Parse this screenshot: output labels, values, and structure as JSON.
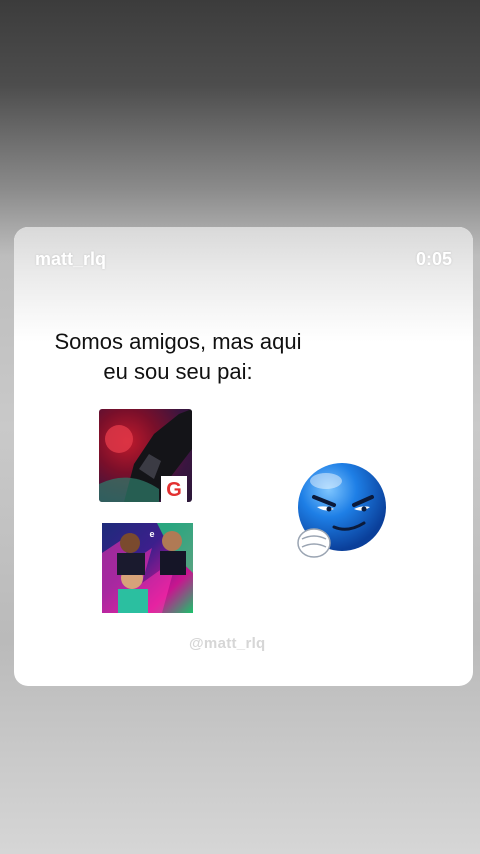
{
  "story": {
    "username": "matt_rlq",
    "timer": "0:05"
  },
  "post": {
    "caption_line1": "Somos amigos, mas aqui",
    "caption_line2": "eu sou seu pai:",
    "watermark": "@matt_rlq"
  },
  "apps": [
    {
      "name": "free-fire-app-icon"
    },
    {
      "name": "efootball-app-icon"
    }
  ],
  "emoji": {
    "name": "smirking-blue-emoji"
  },
  "colors": {
    "card_bg": "#ffffff",
    "header_text": "#ffffff",
    "emoji_blue": "#1e7fe6"
  }
}
